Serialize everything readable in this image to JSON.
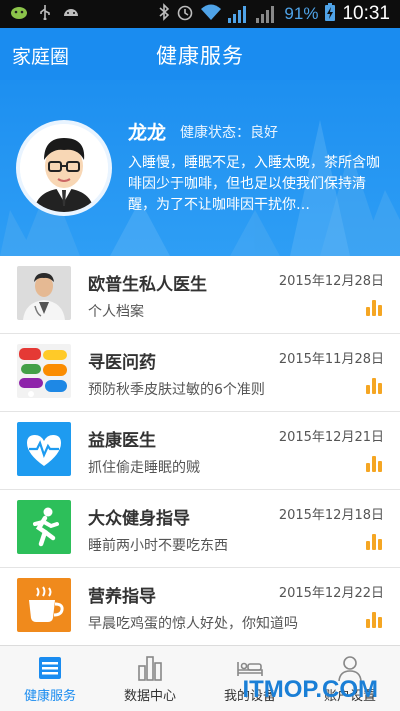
{
  "status_bar": {
    "battery_percent": "91%",
    "time": "10:31",
    "icons": [
      "android-debug-icon",
      "usb-icon",
      "android-icon",
      "bluetooth-icon",
      "alarm-icon",
      "wifi-icon",
      "signal-icon",
      "signal-no-sim-icon",
      "battery-charging-icon"
    ]
  },
  "header": {
    "left_label": "家庭圈",
    "title": "健康服务"
  },
  "profile": {
    "name": "龙龙",
    "status": "健康状态：良好",
    "description": "入睡慢，睡眠不足，入睡太晚，茶所含咖啡因少于咖啡，但也足以使我们保持清醒，为了不让咖啡因干扰你…"
  },
  "items": [
    {
      "title": "欧普生私人医生",
      "subtitle": "个人档案",
      "date": "2015年12月28日",
      "thumb": "doctor-photo"
    },
    {
      "title": "寻医问药",
      "subtitle": "预防秋季皮肤过敏的6个准则",
      "date": "2015年11月28日",
      "thumb": "medicine-photo"
    },
    {
      "title": "益康医生",
      "subtitle": "抓住偷走睡眠的贼",
      "date": "2015年12月21日",
      "thumb": "heartbeat-icon",
      "color": "#1e9bf0"
    },
    {
      "title": "大众健身指导",
      "subtitle": "睡前两小时不要吃东西",
      "date": "2015年12月18日",
      "thumb": "running-icon",
      "color": "#2dbf5a"
    },
    {
      "title": "营养指导",
      "subtitle": "早晨吃鸡蛋的惊人好处，你知道吗",
      "date": "2015年12月22日",
      "thumb": "cup-icon",
      "color": "#f08a1c"
    }
  ],
  "tabs": [
    {
      "label": "健康服务",
      "icon": "list-icon",
      "active": true
    },
    {
      "label": "数据中心",
      "icon": "bar-chart-icon",
      "active": false
    },
    {
      "label": "我的设备",
      "icon": "bed-icon",
      "active": false
    },
    {
      "label": "账户设置",
      "icon": "user-icon",
      "active": false
    }
  ],
  "watermark": "ITMOP.COM",
  "colors": {
    "primary": "#1a8cf0",
    "accent_bars": "#f5a623",
    "active_tab": "#1a8cf0"
  }
}
